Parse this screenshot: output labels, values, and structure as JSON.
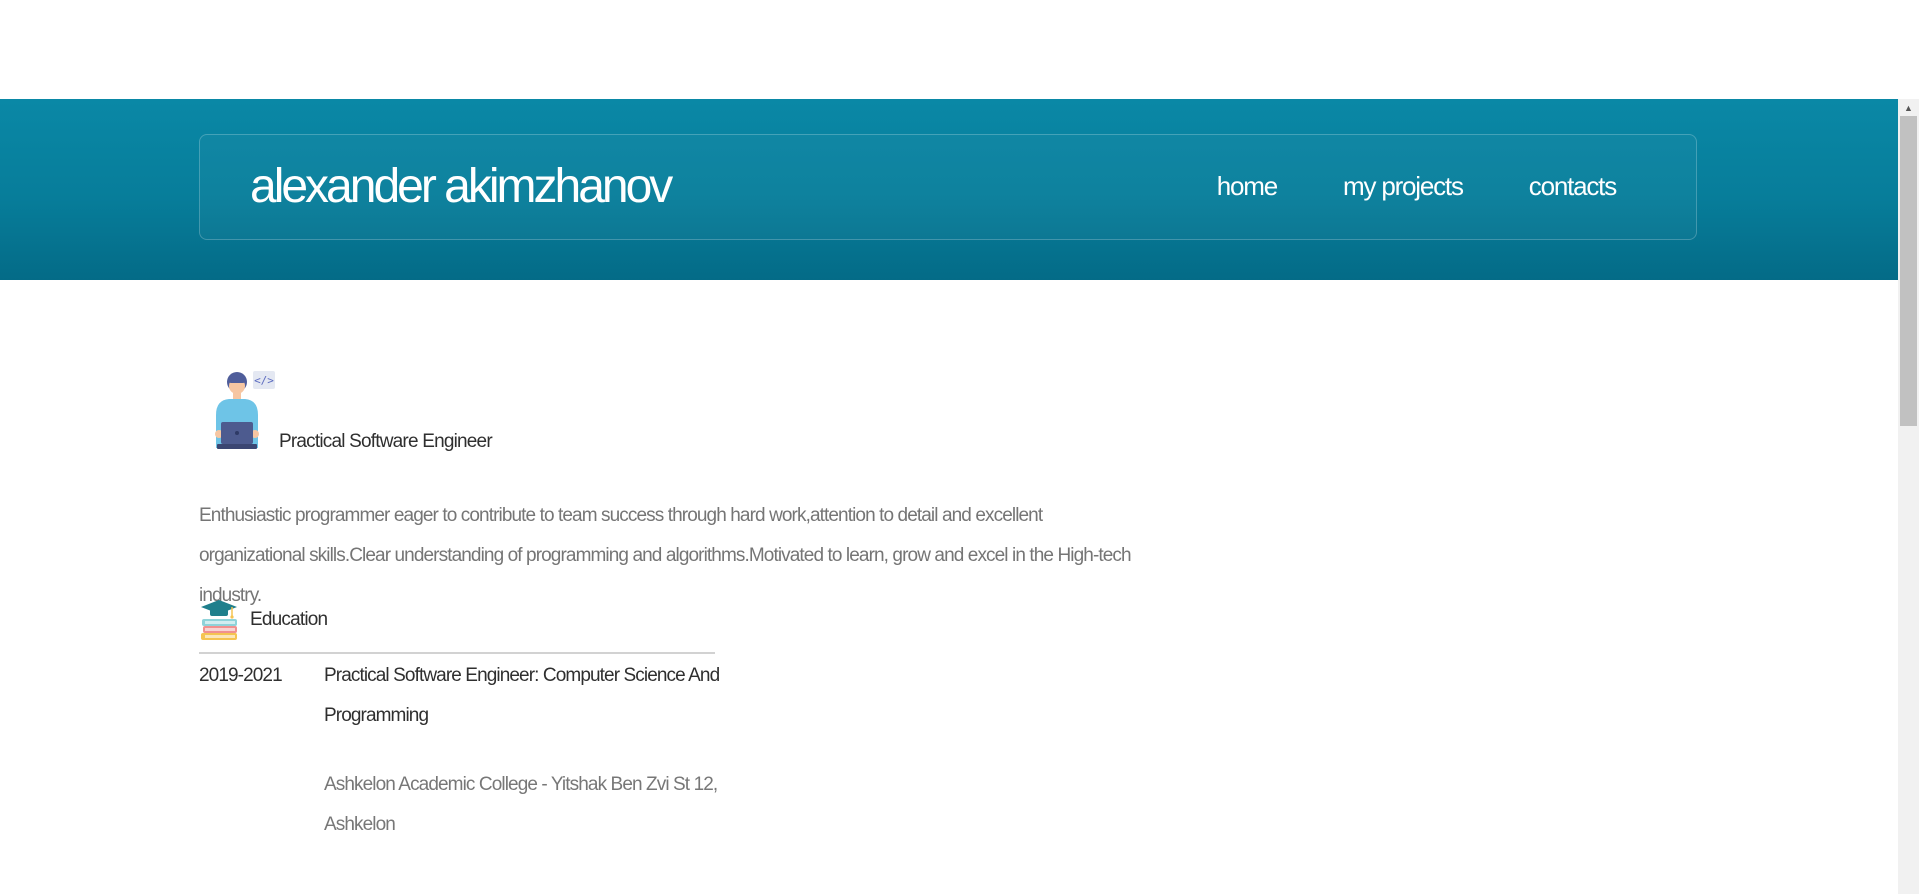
{
  "header": {
    "title": "alexander akimzhanov",
    "nav": [
      {
        "label": "home"
      },
      {
        "label": "my projects"
      },
      {
        "label": "contacts"
      }
    ]
  },
  "profile": {
    "role_icon": "developer-with-laptop-icon",
    "role": "Practical Software Engineer",
    "intro": "Enthusiastic programmer eager to contribute to team success through hard work,attention to detail and excellent organizational skills.Clear understanding of programming and algorithms.Motivated to learn, grow and excel in the High-tech industry."
  },
  "education": {
    "icon": "books-graduation-cap-icon",
    "heading": "Education",
    "entries": [
      {
        "years": "2019-2021",
        "degree": "Practical Software Engineer: Computer Science And Programming",
        "school": "Ashkelon Academic College - Yitshak Ben Zvi St 12, Ashkelon"
      }
    ]
  },
  "colors": {
    "header_bg": "#077d9a",
    "header_text": "#ffffff",
    "body_text": "#2f2f2f",
    "muted_text": "#757575"
  },
  "scrollbar": {
    "up_icon": "triangle-up-icon"
  }
}
